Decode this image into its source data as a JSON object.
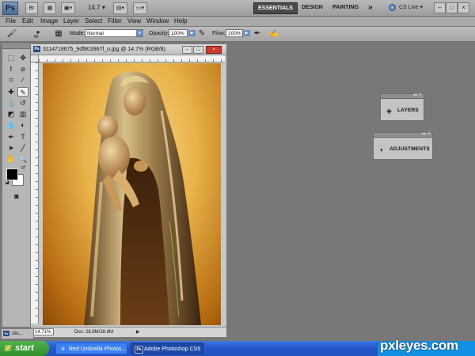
{
  "appbar": {
    "logo": "Ps",
    "launch_bridge": "Br",
    "zoom": "14.7",
    "workspaces": [
      "ESSENTIALS",
      "DESIGN",
      "PAINTING"
    ],
    "more": "»",
    "cs_live": "CS Live",
    "win_minimize": "–",
    "win_restore": "□",
    "win_close": "×"
  },
  "menu": [
    "File",
    "Edit",
    "Image",
    "Layer",
    "Select",
    "Filter",
    "View",
    "Window",
    "Help"
  ],
  "options": {
    "brush_size": "80",
    "mode_label": "Mode:",
    "mode_value": "Normal",
    "opacity_label": "Opacity:",
    "opacity_value": "100%",
    "flow_label": "Flow:",
    "flow_value": "100%"
  },
  "document": {
    "title": "3114718675_9df803967f_o.jpg @ 14.7% (RGB/8)",
    "ps_icon": "Ps",
    "zoom": "14.71%",
    "doc_size": "Doc: 28.8M/28.8M",
    "status_arrow": "▶"
  },
  "panels": {
    "layers": "LAYERS",
    "adjustments": "ADJUSTMENTS"
  },
  "mini_doc": {
    "icon": "Ps",
    "label": "sto..."
  },
  "taskbar": {
    "start": "start",
    "task1": "Red Umbrella Photos...",
    "task2": "Adobe Photoshop CS5"
  },
  "watermark": "pxleyes.com"
}
